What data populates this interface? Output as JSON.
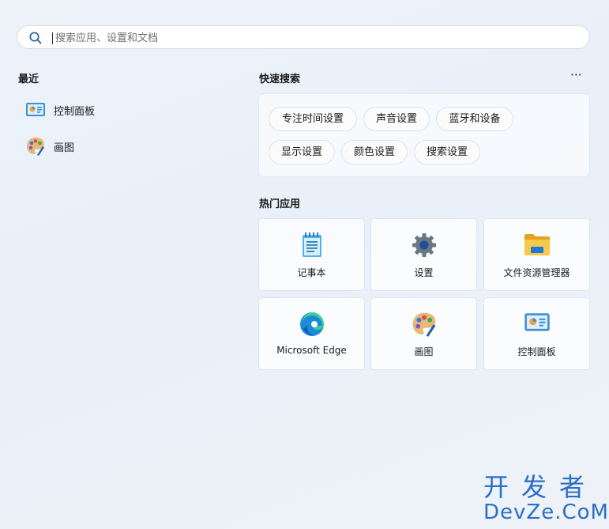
{
  "search": {
    "placeholder": "搜索应用、设置和文档"
  },
  "recent": {
    "title": "最近",
    "items": [
      {
        "label": "控制面板",
        "icon": "control-panel-icon"
      },
      {
        "label": "画图",
        "icon": "paint-icon"
      }
    ]
  },
  "quick_search": {
    "title": "快速搜索",
    "more": "⋯",
    "chips": [
      "专注时间设置",
      "声音设置",
      "蓝牙和设备",
      "显示设置",
      "颜色设置",
      "搜索设置"
    ]
  },
  "top_apps": {
    "title": "热门应用",
    "apps": [
      {
        "label": "记事本",
        "icon": "notepad-icon"
      },
      {
        "label": "设置",
        "icon": "settings-gear-icon"
      },
      {
        "label": "文件资源管理器",
        "icon": "file-explorer-icon"
      },
      {
        "label": "Microsoft Edge",
        "icon": "edge-icon"
      },
      {
        "label": "画图",
        "icon": "paint-icon"
      },
      {
        "label": "控制面板",
        "icon": "control-panel-icon"
      }
    ]
  },
  "watermark": {
    "line1": "开发者",
    "line2": "DevZe.CoM"
  }
}
